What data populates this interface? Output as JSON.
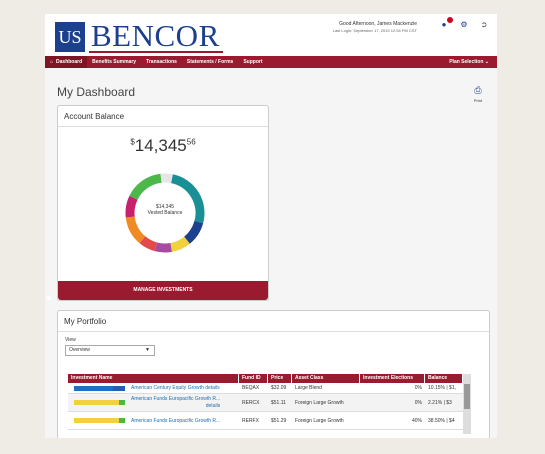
{
  "header": {
    "logo_mark": "US",
    "logo_text": "BENCOR",
    "greeting": "Good Afternoon, James Mackenzie",
    "last_login": "Last Login: September 17, 2019 12:54 PM CST"
  },
  "nav": {
    "items": [
      "Dashboard",
      "Benefits Summary",
      "Transactions",
      "Statements / Forms",
      "Support"
    ],
    "right": "Plan Selection"
  },
  "page": {
    "title": "My Dashboard",
    "print_label": "Print"
  },
  "account": {
    "title": "Account Balance",
    "currency": "$",
    "balance_whole": "14,345",
    "balance_cents": "56",
    "vested_amount": "$14,345",
    "vested_label": "Vested Balance",
    "manage_button": "MANAGE INVESTMENTS",
    "donut_colors": [
      "#1a8f96",
      "#1c3f8e",
      "#f2d13f",
      "#a84aa2",
      "#e34b4b",
      "#f08a24",
      "#c8206b",
      "#4cb849",
      "#e6e6e6"
    ]
  },
  "portfolio": {
    "title": "My Portfolio",
    "view_label": "View",
    "view_value": "Overview",
    "columns": [
      "Investment Name",
      "Fund ID",
      "Price",
      "Asset Class",
      "Investment Elections",
      "Balance"
    ],
    "rows": [
      {
        "name": "American Century Equity Growth details",
        "fund": "BEQAX",
        "price": "$32.09",
        "asset": "Large Blend",
        "election": "0%",
        "balance": "10.15% | $1,"
      },
      {
        "name": "American Funds Europacific Growth R...",
        "detail": "details",
        "fund": "RERCX",
        "price": "$51.11",
        "asset": "Foreign Large Growth",
        "election": "0%",
        "balance": "2.21% | $3"
      },
      {
        "name": "American Funds Europacific Growth R...",
        "fund": "RERFX",
        "price": "$51.29",
        "asset": "Foreign Large Growth",
        "election": "40%",
        "balance": "38.50% | $4"
      }
    ]
  }
}
